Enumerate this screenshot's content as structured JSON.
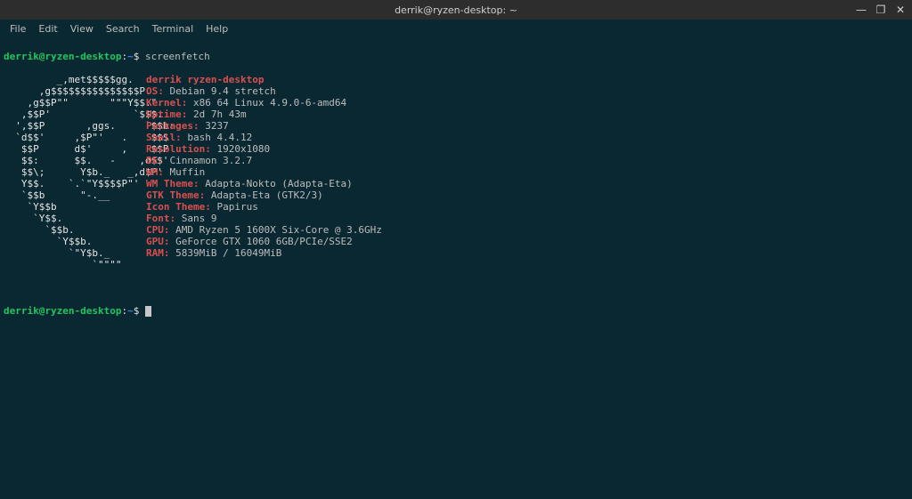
{
  "window": {
    "title": "derrik@ryzen-desktop: ~",
    "controls": {
      "min": "—",
      "max": "❐",
      "close": "✕"
    }
  },
  "menubar": [
    "File",
    "Edit",
    "View",
    "Search",
    "Terminal",
    "Help"
  ],
  "prompt": {
    "user_host": "derrik@ryzen-desktop",
    "sep": ":",
    "path": "~",
    "dollar": "$",
    "command": "screenfetch"
  },
  "ascii": [
    "         _,met$$$$$gg.",
    "      ,g$$$$$$$$$$$$$$$P.",
    "    ,g$$P\"\"       \"\"\"Y$$.\".",
    "   ,$$P'              `$$$.",
    "  ',$$P       ,ggs.     `$$b:",
    "  `d$$'     ,$P\"'   .    $$$",
    "   $$P      d$'     ,    $$P",
    "   $$:      $$.   -    ,d$$'",
    "   $$\\;      Y$b._   _,d$P'",
    "   Y$$.    `.`\"Y$$$$P\"'",
    "   `$$b      \"-.__",
    "    `Y$$b",
    "     `Y$$.",
    "       `$$b.",
    "         `Y$$b.",
    "           `\"Y$b._",
    "               `\"\"\"\""
  ],
  "info": {
    "header": "derrik ryzen-desktop",
    "items": [
      {
        "label": "OS:",
        "value": "Debian 9.4 stretch"
      },
      {
        "label": "Kernel:",
        "value": "x86 64 Linux 4.9.0-6-amd64"
      },
      {
        "label": "Uptime:",
        "value": "2d 7h 43m"
      },
      {
        "label": "Packages:",
        "value": "3237"
      },
      {
        "label": "Shell:",
        "value": "bash 4.4.12"
      },
      {
        "label": "Resolution:",
        "value": "1920x1080"
      },
      {
        "label": "DE:",
        "value": "Cinnamon 3.2.7"
      },
      {
        "label": "WM:",
        "value": "Muffin"
      },
      {
        "label": "WM Theme:",
        "value": "Adapta-Nokto (Adapta-Eta)"
      },
      {
        "label": "GTK Theme:",
        "value": "Adapta-Eta (GTK2/3)"
      },
      {
        "label": "Icon Theme:",
        "value": "Papirus"
      },
      {
        "label": "Font:",
        "value": "Sans 9"
      },
      {
        "label": "CPU:",
        "value": "AMD Ryzen 5 1600X Six-Core @ 3.6GHz"
      },
      {
        "label": "GPU:",
        "value": "GeForce GTX 1060 6GB/PCIe/SSE2"
      },
      {
        "label": "RAM:",
        "value": "5839MiB / 16049MiB"
      }
    ]
  }
}
